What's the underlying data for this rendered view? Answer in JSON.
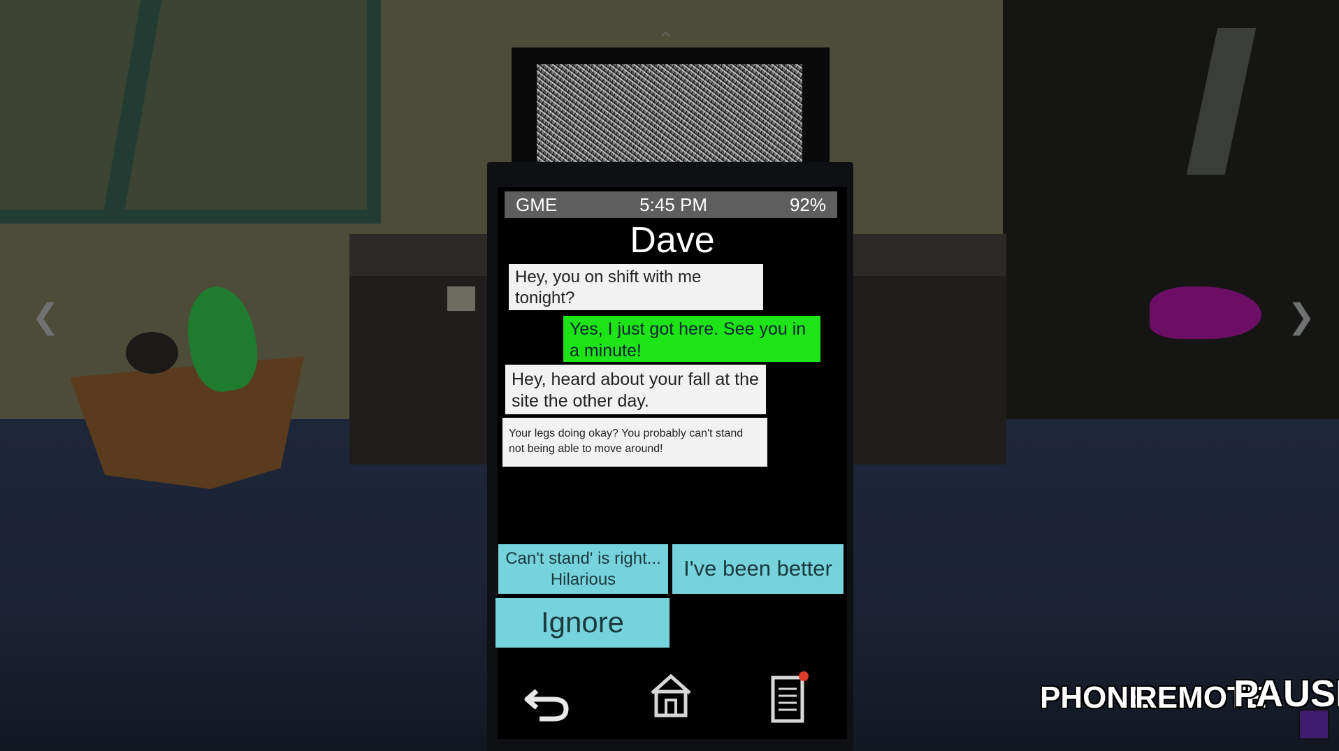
{
  "phone": {
    "status": {
      "carrier": "GME",
      "time": "5:45 PM",
      "battery": "92%"
    },
    "contact_name": "Dave",
    "messages": [
      {
        "sender": "them",
        "text": "Hey, you on shift with me tonight?"
      },
      {
        "sender": "me",
        "text": "Yes, I just got here. See you in a minute!"
      },
      {
        "sender": "them",
        "text": "Hey, heard about your fall at the site the other day."
      },
      {
        "sender": "them",
        "text": "Your legs doing okay? You probably can't stand not being able to move around!"
      }
    ],
    "replies": [
      {
        "label": "Can't stand' is right... Hilarious"
      },
      {
        "label": "I've been better"
      },
      {
        "label": "Ignore"
      }
    ],
    "nav": [
      "back-icon",
      "home-icon",
      "notes-icon"
    ]
  },
  "hud": {
    "phone": "PHONE",
    "remote": "REMOTE",
    "pause": "PAUSE"
  },
  "colors": {
    "sent_bubble": "#1de415",
    "received_bubble": "#f2f2f2",
    "reply_button": "#77d3db",
    "statusbar": "#5e5e5e"
  }
}
